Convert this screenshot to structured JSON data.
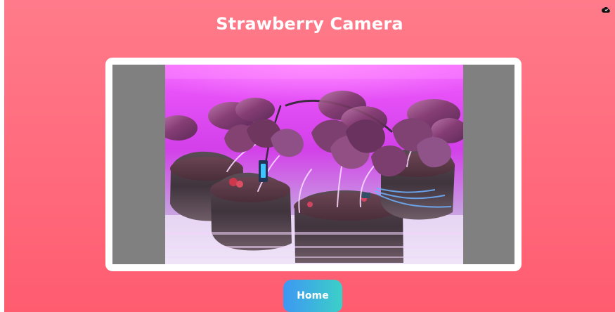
{
  "page": {
    "title": "Strawberry Camera"
  },
  "header": {
    "icon": "cloud-icon"
  },
  "camera": {
    "image_subject": "strawberry-plants-in-grow-bags"
  },
  "navigation": {
    "home_label": "Home"
  },
  "colors": {
    "background_top": "#ff7b8a",
    "background_bottom": "#ff5c70",
    "frame": "#ffffff",
    "letterbox": "#808080",
    "button_left": "#3e97f3",
    "button_right": "#3bd0c8",
    "image_tint": "#d93be8"
  }
}
